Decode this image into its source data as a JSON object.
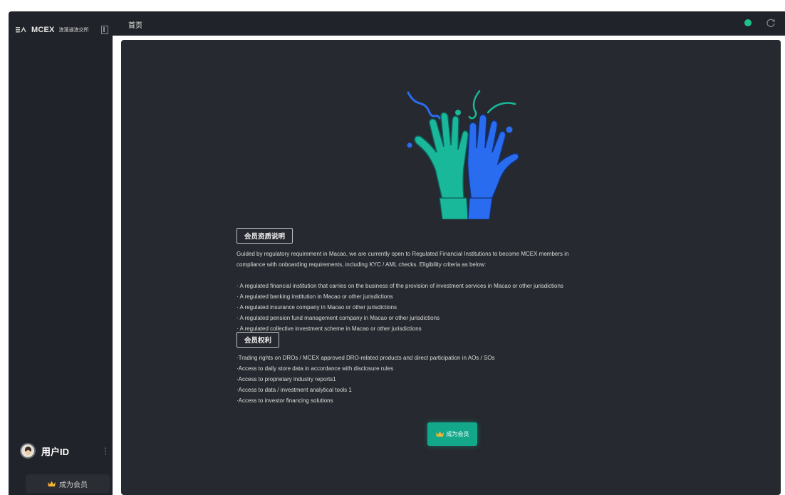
{
  "sidebar": {
    "brand_name": "MCEX",
    "brand_sub": "澳滙通澳交所",
    "user_id": "用户ID",
    "more": "⋮",
    "member_button": "成为会员"
  },
  "topbar": {
    "title": "首页"
  },
  "main": {
    "section1": {
      "title": "会员资质说明",
      "paragraph": [
        "Guided by regulatory requirement in Macao, we are currently open to Regulated Financial Institutions to become MCEX members in",
        "compliance with onboarding requirements, including KYC / AML checks. Eligibility criteria as below:"
      ],
      "items": [
        "· A regulated financial institution that carries on the business of the provision of investment services in Macao or other jurisdictions",
        "· A regulated banking institution in Macao or other jurisdictions",
        "· A regulated insurance company in Macao or other jurisdictions",
        "· A regulated pension fund management company in Macao or other jurisdictions",
        "· A regulated collective investment scheme in Macao or other jurisdictions"
      ]
    },
    "section2": {
      "title": "会员权利",
      "items": [
        "·Trading rights on DROs / MCEX approved DRO-related products and direct participation in AOs / SOs",
        "·Access to daily store data in accordance with disclosure rules",
        "·Access to proprietary industry reports1",
        "·Access to data / investment analytical tools 1",
        "·Access to investor financing solutions"
      ]
    },
    "become_member_button": "成为会员"
  },
  "colors": {
    "accent": "#14a88b",
    "status": "#1ec28a",
    "hand_left": "#19b89a",
    "hand_right": "#2a6cf0"
  }
}
